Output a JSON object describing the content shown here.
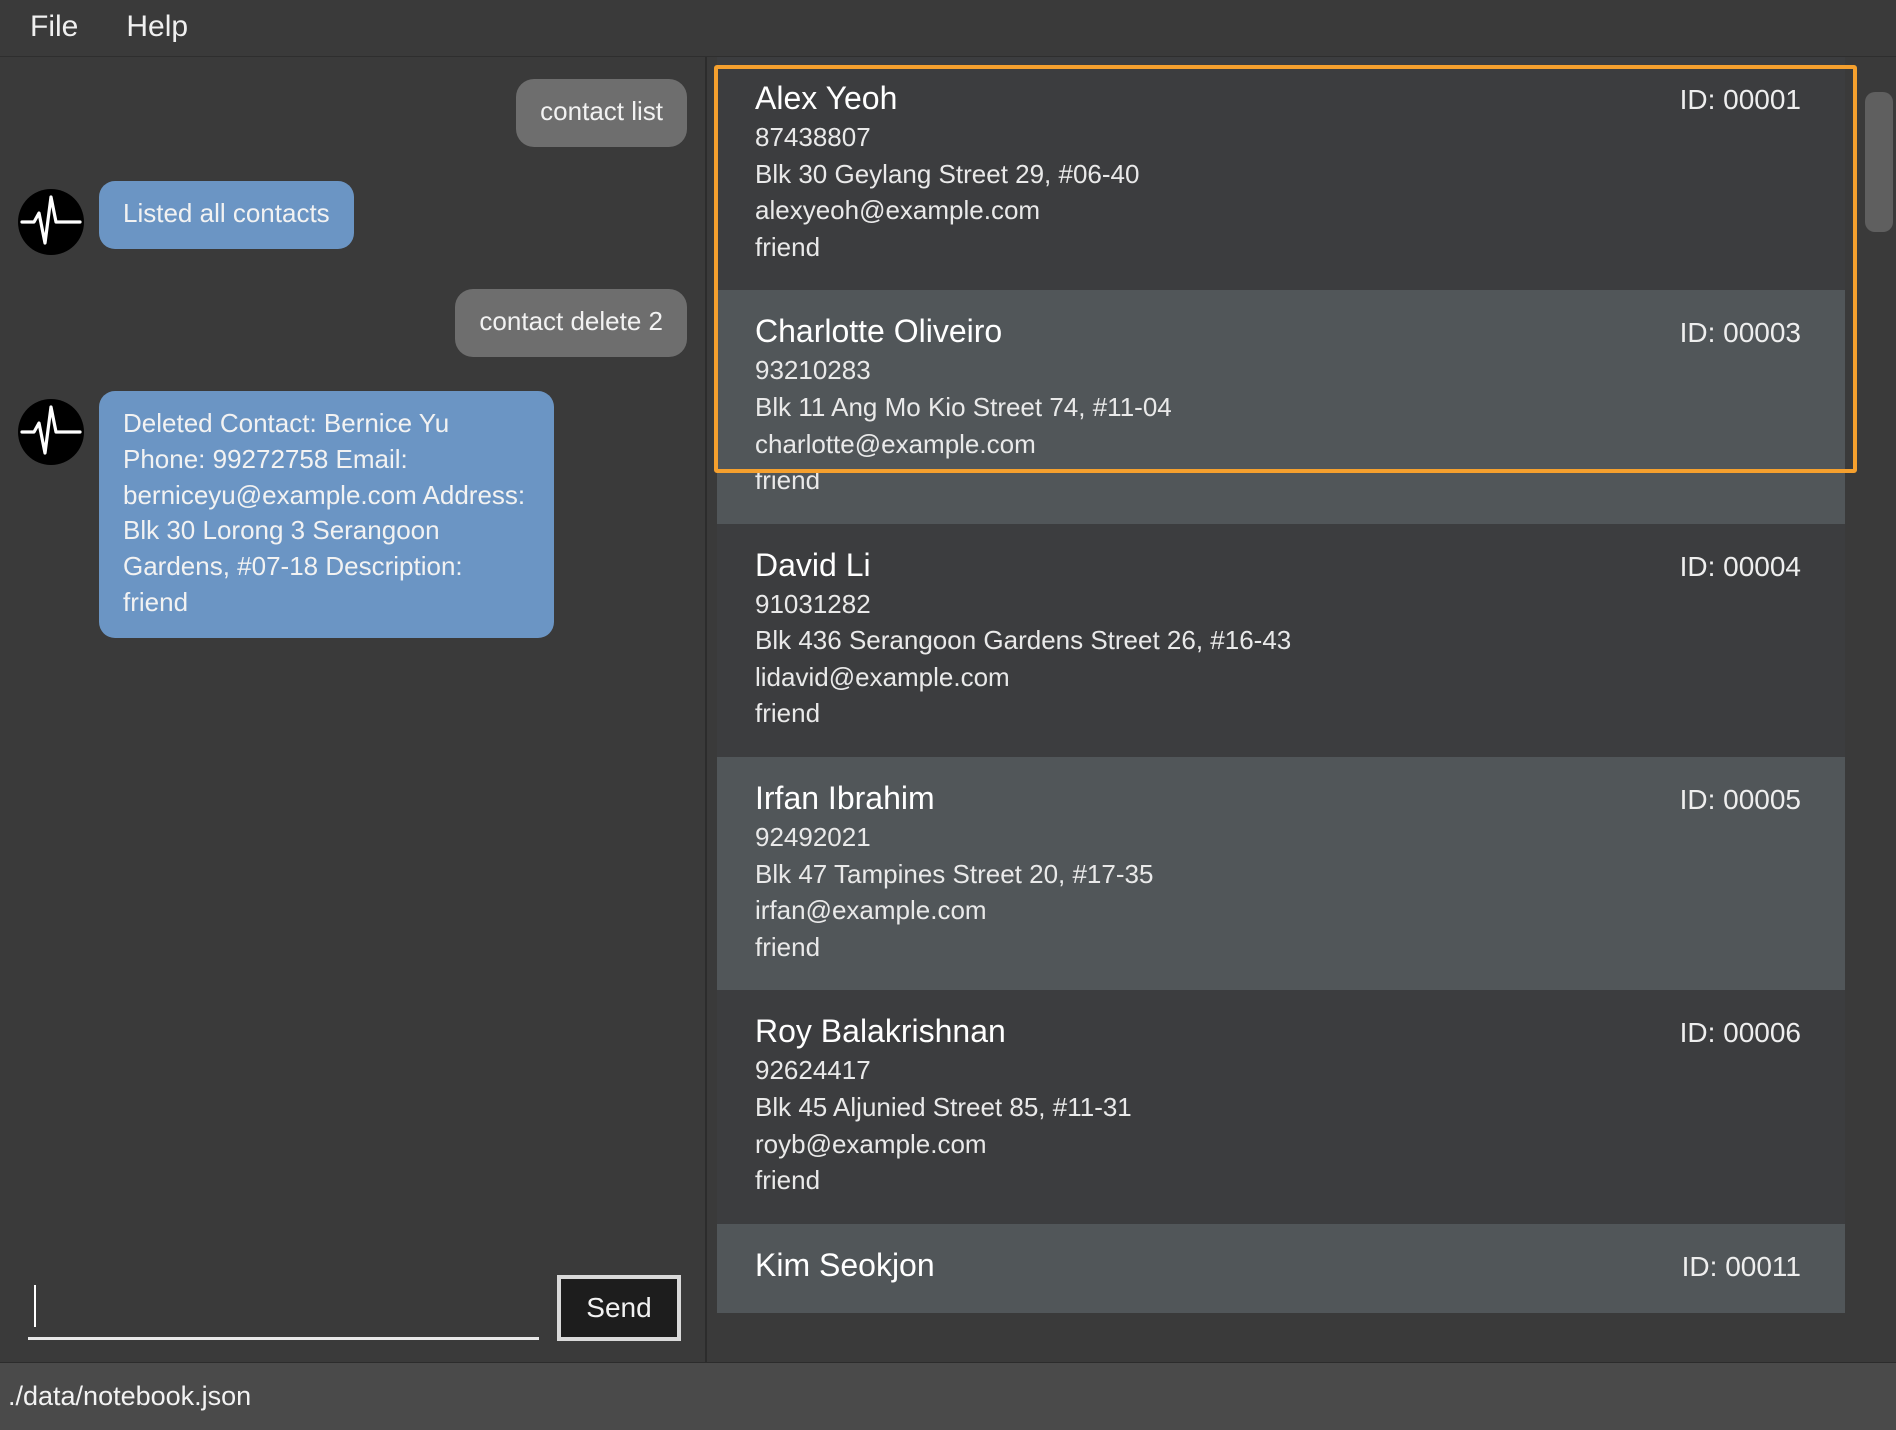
{
  "menu": {
    "items": [
      {
        "label": "File"
      },
      {
        "label": "Help"
      }
    ]
  },
  "chat": {
    "messages": [
      {
        "sender": "user",
        "text": "contact list",
        "avatar_icon": "pulse-avatar-icon"
      },
      {
        "sender": "bot",
        "text": "Listed all contacts",
        "avatar_icon": "pulse-avatar-icon"
      },
      {
        "sender": "user",
        "text": "contact delete 2",
        "avatar_icon": "pulse-avatar-icon"
      },
      {
        "sender": "bot",
        "text": "Deleted Contact: Bernice Yu Phone: 99272758 Email: berniceyu@example.com Address: Blk 30 Lorong 3 Serangoon Gardens, #07-18 Description: friend",
        "avatar_icon": "pulse-avatar-icon"
      }
    ],
    "input": {
      "value": "",
      "placeholder": ""
    },
    "send_label": "Send"
  },
  "contact_list": {
    "id_prefix": "ID: ",
    "contacts": [
      {
        "name": "Alex Yeoh",
        "id": "ID: 00001",
        "phone": "87438807",
        "address": "Blk 30 Geylang Street 29, #06-40",
        "email": "alexyeoh@example.com",
        "tag": "friend",
        "row_style": "plain",
        "selected": true
      },
      {
        "name": "Charlotte Oliveiro",
        "id": "ID: 00003",
        "phone": "93210283",
        "address": "Blk 11 Ang Mo Kio Street 74, #11-04",
        "email": "charlotte@example.com",
        "tag": "friend",
        "row_style": "alt",
        "selected": true
      },
      {
        "name": "David Li",
        "id": "ID: 00004",
        "phone": "91031282",
        "address": "Blk 436 Serangoon Gardens Street 26, #16-43",
        "email": "lidavid@example.com",
        "tag": "friend",
        "row_style": "plain",
        "selected": false
      },
      {
        "name": "Irfan Ibrahim",
        "id": "ID: 00005",
        "phone": "92492021",
        "address": "Blk 47 Tampines Street 20, #17-35",
        "email": "irfan@example.com",
        "tag": "friend",
        "row_style": "alt",
        "selected": false
      },
      {
        "name": "Roy Balakrishnan",
        "id": "ID: 00006",
        "phone": "92624417",
        "address": "Blk 45 Aljunied Street 85, #11-31",
        "email": "royb@example.com",
        "tag": "friend",
        "row_style": "plain",
        "selected": false
      },
      {
        "name": "Kim Seokjon",
        "id": "ID: 00011",
        "phone": "",
        "address": "",
        "email": "",
        "tag": "",
        "row_style": "alt",
        "selected": false
      }
    ]
  },
  "statusbar": {
    "file_path": "./data/notebook.json"
  },
  "colors": {
    "selection_outline": "#f5a02e",
    "bot_bubble": "#6b95c4",
    "user_bubble": "#6e6e6e",
    "row_alt": "#515659",
    "row_plain": "#3c3d3f",
    "window_bg": "#3a3a3a",
    "statusbar_bg": "#4a4a4a"
  }
}
